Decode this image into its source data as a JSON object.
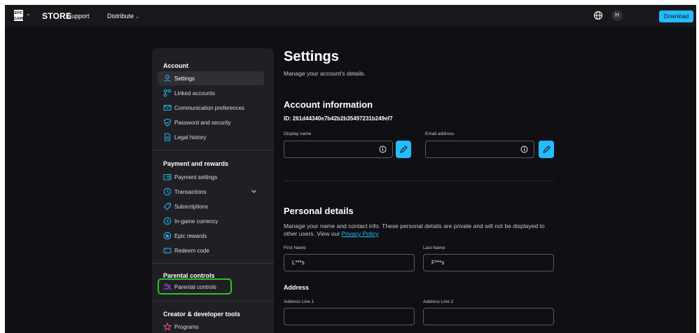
{
  "topbar": {
    "logo_text": "EPIC\nGAMES",
    "store": "STORE",
    "support": "Support",
    "distribute": "Distribute",
    "avatar_initial": "H",
    "download": "Download"
  },
  "sidebar": {
    "sections": [
      {
        "title": "Account",
        "items": [
          {
            "label": "Settings",
            "icon": "user-icon",
            "active": true
          },
          {
            "label": "Linked accounts",
            "icon": "link-nodes-icon"
          },
          {
            "label": "Communication preferences",
            "icon": "mail-icon"
          },
          {
            "label": "Password and security",
            "icon": "shield-icon"
          },
          {
            "label": "Legal history",
            "icon": "document-icon"
          }
        ]
      },
      {
        "title": "Payment and rewards",
        "items": [
          {
            "label": "Payment settings",
            "icon": "wallet-icon"
          },
          {
            "label": "Transactions",
            "icon": "clock-icon",
            "expandable": true
          },
          {
            "label": "Subscriptions",
            "icon": "tag-icon"
          },
          {
            "label": "In-game currency",
            "icon": "coin-icon"
          },
          {
            "label": "Epic rewards",
            "icon": "reward-icon"
          },
          {
            "label": "Redeem code",
            "icon": "ticket-icon"
          }
        ]
      },
      {
        "title": "Parental controls",
        "items": [
          {
            "label": "Parental controls",
            "icon": "family-icon"
          }
        ]
      },
      {
        "title": "Creator & developer tools",
        "items": [
          {
            "label": "Programs",
            "icon": "star-icon"
          }
        ]
      }
    ]
  },
  "main": {
    "title": "Settings",
    "subtitle": "Manage your account's details.",
    "account_info": {
      "heading": "Account information",
      "id_line": "ID: 261d44340e7b42b2b35497231b249ef7",
      "display_name_label": "Display name",
      "display_name_value": "",
      "email_label": "Email address",
      "email_value": ""
    },
    "personal": {
      "heading": "Personal details",
      "description": "Manage your name and contact info. These personal details are private and will not be displayed to other users. View our ",
      "privacy_link": "Privacy Policy",
      "first_name_label": "First Name",
      "first_name_value": "L***s",
      "last_name_label": "Last Name",
      "last_name_value": "F***s"
    },
    "address": {
      "heading": "Address",
      "line1_label": "Address Line 1",
      "line1_value": "",
      "line2_label": "Address Line 2",
      "line2_value": ""
    }
  },
  "colors": {
    "accent": "#26bbff",
    "background": "#101014",
    "sidebar": "#202024",
    "highlight": "#2bc22b"
  }
}
